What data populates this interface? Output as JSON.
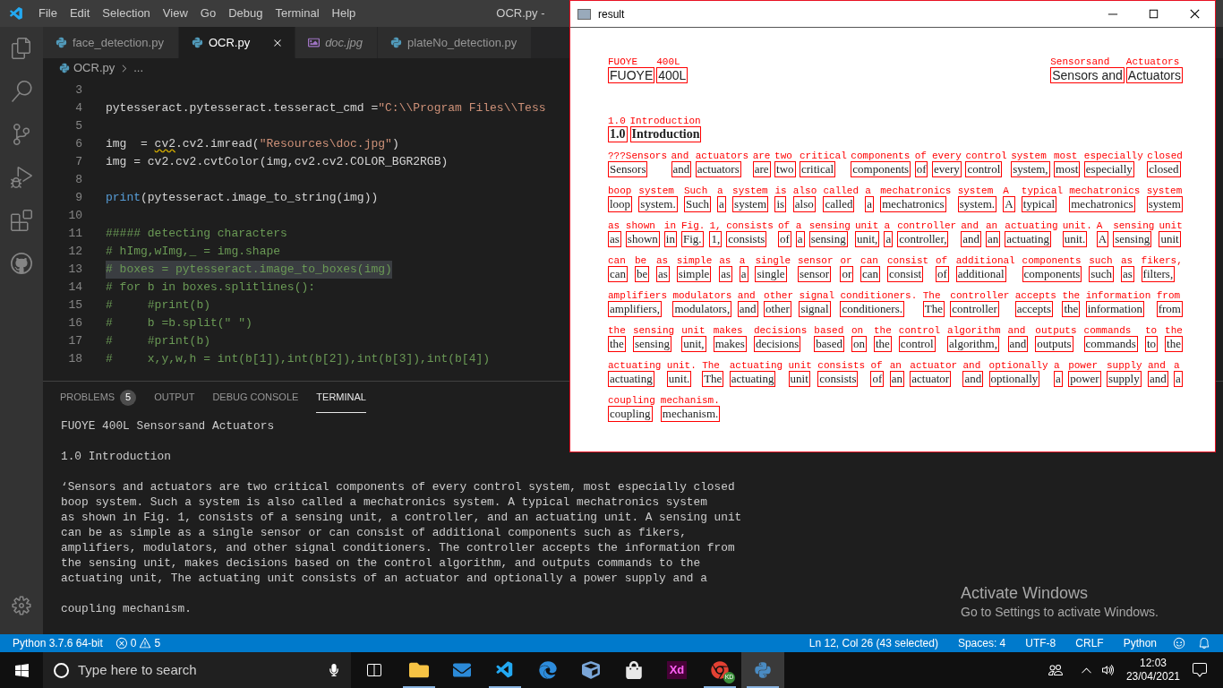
{
  "title_bar": {
    "menu": [
      "File",
      "Edit",
      "Selection",
      "View",
      "Go",
      "Debug",
      "Terminal",
      "Help"
    ],
    "title": "OCR.py -"
  },
  "tabs": [
    {
      "label": "face_detection.py",
      "kind": "python",
      "selected": false,
      "italic": false
    },
    {
      "label": "OCR.py",
      "kind": "python",
      "selected": true,
      "italic": false
    },
    {
      "label": "doc.jpg",
      "kind": "image",
      "selected": false,
      "italic": true
    },
    {
      "label": "plateNo_detection.py",
      "kind": "python",
      "selected": false,
      "italic": false
    }
  ],
  "breadcrumb": [
    "OCR.py",
    "..."
  ],
  "code_lines": [
    {
      "number": "3"
    },
    {
      "number": "4",
      "segments": [
        {
          "t": "pytesseract.pytesseract.tesseract_cmd =",
          "kind": "plain",
          "selected": false
        },
        {
          "t": "\"C:\\\\Program Files\\\\Tess",
          "kind": "string",
          "selected": false
        }
      ]
    },
    {
      "number": "5"
    },
    {
      "number": "6",
      "segments": [
        {
          "t": "img  = ",
          "kind": "plain",
          "selected": false
        },
        {
          "t": "cv2",
          "kind": "plain",
          "selected": false,
          "squiggle": true
        },
        {
          "t": ".cv2.imread(",
          "kind": "plain",
          "selected": false
        },
        {
          "t": "\"Resources\\doc.jpg\"",
          "kind": "string",
          "selected": false
        },
        {
          "t": ")",
          "kind": "plain",
          "selected": false
        }
      ]
    },
    {
      "number": "7",
      "segments": [
        {
          "t": "img = cv2.cv2.cvtColor(img,cv2.cv2.COLOR_BGR2RGB)",
          "kind": "plain",
          "selected": false
        }
      ]
    },
    {
      "number": "8"
    },
    {
      "number": "9",
      "segments": [
        {
          "t": "print",
          "kind": "keyword",
          "selected": false
        },
        {
          "t": "(pytesseract.image_to_string(img))",
          "kind": "plain",
          "selected": false
        }
      ]
    },
    {
      "number": "10"
    },
    {
      "number": "11",
      "segments": [
        {
          "t": "##### detecting characters",
          "kind": "comment",
          "selected": false
        }
      ]
    },
    {
      "number": "12",
      "segments": [
        {
          "t": "# hImg,wImg,_ = img.shape",
          "kind": "comment",
          "selected": false
        }
      ]
    },
    {
      "number": "13",
      "segments": [
        {
          "t": "# boxes = pytesseract.image_to_boxes(img)",
          "kind": "comment",
          "selected": true
        }
      ]
    },
    {
      "number": "14",
      "segments": [
        {
          "t": "# for b in boxes.splitlines():",
          "kind": "comment",
          "selected": false
        }
      ]
    },
    {
      "number": "15",
      "segments": [
        {
          "t": "#     #print(b)",
          "kind": "comment",
          "selected": false
        }
      ]
    },
    {
      "number": "16",
      "segments": [
        {
          "t": "#     b =b.split(\" \")",
          "kind": "comment",
          "selected": false
        }
      ]
    },
    {
      "number": "17",
      "segments": [
        {
          "t": "#     #print(b)",
          "kind": "comment",
          "selected": false
        }
      ]
    },
    {
      "number": "18",
      "segments": [
        {
          "t": "#     x,y,w,h = int(b[1]),int(b[2]),int(b[3]),int(b[4])",
          "kind": "comment",
          "selected": false
        }
      ]
    }
  ],
  "panel_tabs": [
    {
      "label": "PROBLEMS",
      "badge": "5",
      "selected": false
    },
    {
      "label": "OUTPUT",
      "selected": false
    },
    {
      "label": "DEBUG CONSOLE",
      "selected": false
    },
    {
      "label": "TERMINAL",
      "selected": true
    }
  ],
  "terminal": [
    [
      "FUOYE 400L Sensorsand Actuators"
    ],
    [
      "1.0 Introduction"
    ],
    [
      "‘Sensors and actuators are two critical components of every control system, most especially closed",
      "boop system. Such a system is also called a mechatronics system. A typical mechatronics system",
      "as shown in Fig. 1, consists of a sensing unit, a controller, and an actuating unit. A sensing unit",
      "can be as simple as a single sensor or can consist of additional components such as fikers,",
      "amplifiers, modulators, and other signal conditioners. The controller accepts the information from",
      "the sensing unit, makes decisions based on the control algorithm, and outputs commands to the",
      "actuating unit, The actuating unit consists of an actuator and optionally a power supply and a"
    ],
    [
      "coupling mechanism."
    ]
  ],
  "status_bar": {
    "interpreter": "Python 3.7.6 64-bit",
    "errors": "0",
    "warnings": "5",
    "right": [
      "Ln 12, Col 26 (43 selected)",
      "Spaces: 4",
      "UTF-8",
      "CRLF",
      "Python"
    ]
  },
  "result_window": {
    "title": "result",
    "header_left": [
      {
        "text": "FUOYE",
        "ocr": "FUOYE"
      },
      {
        "text": "400L",
        "ocr": "400L"
      }
    ],
    "header_right": [
      {
        "text": "Sensors and",
        "ocr": "Sensorsand"
      },
      {
        "text": "Actuators",
        "ocr": "Actuators"
      }
    ],
    "heading": [
      {
        "text": "1.0",
        "ocr": "1.0"
      },
      {
        "text": "Introduction",
        "ocr": "Introduction"
      }
    ],
    "lines": [
      {
        "words": [
          {
            "text": "Sensors",
            "ocr": "???Sensors"
          },
          {
            "text": "and",
            "ocr": "and"
          },
          {
            "text": "actuators",
            "ocr": "actuators"
          },
          {
            "text": "are",
            "ocr": "are"
          },
          {
            "text": "two",
            "ocr": "two"
          },
          {
            "text": "critical",
            "ocr": "critical"
          },
          {
            "text": "components",
            "ocr": "components"
          },
          {
            "text": "of",
            "ocr": "of"
          },
          {
            "text": "every",
            "ocr": "every"
          },
          {
            "text": "control",
            "ocr": "control"
          },
          {
            "text": "system,",
            "ocr": "system"
          },
          {
            "text": "most",
            "ocr": "most"
          },
          {
            "text": "especially",
            "ocr": "especially"
          },
          {
            "text": "closed",
            "ocr": "closed"
          }
        ]
      },
      {
        "words": [
          {
            "text": "loop",
            "ocr": "boop"
          },
          {
            "text": "system.",
            "ocr": "system"
          },
          {
            "text": "Such",
            "ocr": "Such"
          },
          {
            "text": "a",
            "ocr": "a"
          },
          {
            "text": "system",
            "ocr": "system"
          },
          {
            "text": "is",
            "ocr": "is"
          },
          {
            "text": "also",
            "ocr": "also"
          },
          {
            "text": "called",
            "ocr": "called"
          },
          {
            "text": "a",
            "ocr": "a"
          },
          {
            "text": "mechatronics",
            "ocr": "mechatronics"
          },
          {
            "text": "system.",
            "ocr": "system"
          },
          {
            "text": "A",
            "ocr": "A"
          },
          {
            "text": "typical",
            "ocr": "typical"
          },
          {
            "text": "mechatronics",
            "ocr": "mechatronics"
          },
          {
            "text": "system",
            "ocr": "system"
          }
        ]
      },
      {
        "words": [
          {
            "text": "as",
            "ocr": "as"
          },
          {
            "text": "shown",
            "ocr": "shown"
          },
          {
            "text": "in",
            "ocr": "in"
          },
          {
            "text": "Fig.",
            "ocr": "Fig."
          },
          {
            "text": "1,",
            "ocr": "1,"
          },
          {
            "text": "consists",
            "ocr": "consists"
          },
          {
            "text": "of",
            "ocr": "of"
          },
          {
            "text": "a",
            "ocr": "a"
          },
          {
            "text": "sensing",
            "ocr": "sensing"
          },
          {
            "text": "unit,",
            "ocr": "unit"
          },
          {
            "text": "a",
            "ocr": "a"
          },
          {
            "text": "controller,",
            "ocr": "controller"
          },
          {
            "text": "and",
            "ocr": "and"
          },
          {
            "text": "an",
            "ocr": "an"
          },
          {
            "text": "actuating",
            "ocr": "actuating"
          },
          {
            "text": "unit.",
            "ocr": "unit."
          },
          {
            "text": "A",
            "ocr": "A"
          },
          {
            "text": "sensing",
            "ocr": "sensing"
          },
          {
            "text": "unit",
            "ocr": "unit"
          }
        ]
      },
      {
        "words": [
          {
            "text": "can",
            "ocr": "can"
          },
          {
            "text": "be",
            "ocr": "be"
          },
          {
            "text": "as",
            "ocr": "as"
          },
          {
            "text": "simple",
            "ocr": "simple"
          },
          {
            "text": "as",
            "ocr": "as"
          },
          {
            "text": "a",
            "ocr": "a"
          },
          {
            "text": "single",
            "ocr": "single"
          },
          {
            "text": "sensor",
            "ocr": "sensor"
          },
          {
            "text": "or",
            "ocr": "or"
          },
          {
            "text": "can",
            "ocr": "can"
          },
          {
            "text": "consist",
            "ocr": "consist"
          },
          {
            "text": "of",
            "ocr": "of"
          },
          {
            "text": "additional",
            "ocr": "additional"
          },
          {
            "text": "components",
            "ocr": "components"
          },
          {
            "text": "such",
            "ocr": "such"
          },
          {
            "text": "as",
            "ocr": "as"
          },
          {
            "text": "filters,",
            "ocr": "fikers,"
          }
        ]
      },
      {
        "words": [
          {
            "text": "amplifiers,",
            "ocr": "amplifiers"
          },
          {
            "text": "modulators,",
            "ocr": "modulators"
          },
          {
            "text": "and",
            "ocr": "and"
          },
          {
            "text": "other",
            "ocr": "other"
          },
          {
            "text": "signal",
            "ocr": "signal"
          },
          {
            "text": "conditioners.",
            "ocr": "conditioners."
          },
          {
            "text": "The",
            "ocr": "The"
          },
          {
            "text": "controller",
            "ocr": "controller"
          },
          {
            "text": "accepts",
            "ocr": "accepts"
          },
          {
            "text": "the",
            "ocr": "the"
          },
          {
            "text": "information",
            "ocr": "information"
          },
          {
            "text": "from",
            "ocr": "from"
          }
        ]
      },
      {
        "words": [
          {
            "text": "the",
            "ocr": "the"
          },
          {
            "text": "sensing",
            "ocr": "sensing"
          },
          {
            "text": "unit,",
            "ocr": "unit"
          },
          {
            "text": "makes",
            "ocr": "makes"
          },
          {
            "text": "decisions",
            "ocr": "decisions"
          },
          {
            "text": "based",
            "ocr": "based"
          },
          {
            "text": "on",
            "ocr": "on"
          },
          {
            "text": "the",
            "ocr": "the"
          },
          {
            "text": "control",
            "ocr": "control"
          },
          {
            "text": "algorithm,",
            "ocr": "algorithm"
          },
          {
            "text": "and",
            "ocr": "and"
          },
          {
            "text": "outputs",
            "ocr": "outputs"
          },
          {
            "text": "commands",
            "ocr": "commands"
          },
          {
            "text": "to",
            "ocr": "to"
          },
          {
            "text": "the",
            "ocr": "the"
          }
        ]
      },
      {
        "words": [
          {
            "text": "actuating",
            "ocr": "actuating"
          },
          {
            "text": "unit.",
            "ocr": "unit."
          },
          {
            "text": "The",
            "ocr": "The"
          },
          {
            "text": "actuating",
            "ocr": "actuating"
          },
          {
            "text": "unit",
            "ocr": "unit"
          },
          {
            "text": "consists",
            "ocr": "consists"
          },
          {
            "text": "of",
            "ocr": "of"
          },
          {
            "text": "an",
            "ocr": "an"
          },
          {
            "text": "actuator",
            "ocr": "actuator"
          },
          {
            "text": "and",
            "ocr": "and"
          },
          {
            "text": "optionally",
            "ocr": "optionally"
          },
          {
            "text": "a",
            "ocr": "a"
          },
          {
            "text": "power",
            "ocr": "power"
          },
          {
            "text": "supply",
            "ocr": "supply"
          },
          {
            "text": "and",
            "ocr": "and"
          },
          {
            "text": "a",
            "ocr": "a"
          }
        ]
      },
      {
        "words": [
          {
            "text": "coupling",
            "ocr": "coupling"
          },
          {
            "text": "mechanism.",
            "ocr": "mechanism."
          }
        ]
      }
    ]
  },
  "activation_notice": {
    "title": "Activate Windows",
    "text": "Go to Settings to activate Windows."
  },
  "taskbar": {
    "search_placeholder": "Type here to search",
    "apps": [
      {
        "kind": "folder",
        "running": true,
        "selected": false
      },
      {
        "kind": "mail",
        "running": false,
        "selected": false
      },
      {
        "kind": "vscode",
        "running": true,
        "selected": false
      },
      {
        "kind": "edge",
        "running": false,
        "selected": false
      },
      {
        "kind": "virtualbox",
        "running": false,
        "selected": false
      },
      {
        "kind": "store",
        "running": false,
        "selected": false
      },
      {
        "kind": "xd",
        "label": "Xd",
        "running": false,
        "selected": false
      },
      {
        "kind": "chrome",
        "badge": "KD",
        "running": true,
        "selected": false
      },
      {
        "kind": "python",
        "running": true,
        "selected": true
      }
    ],
    "time": "12:03",
    "date": "23/04/2021"
  }
}
